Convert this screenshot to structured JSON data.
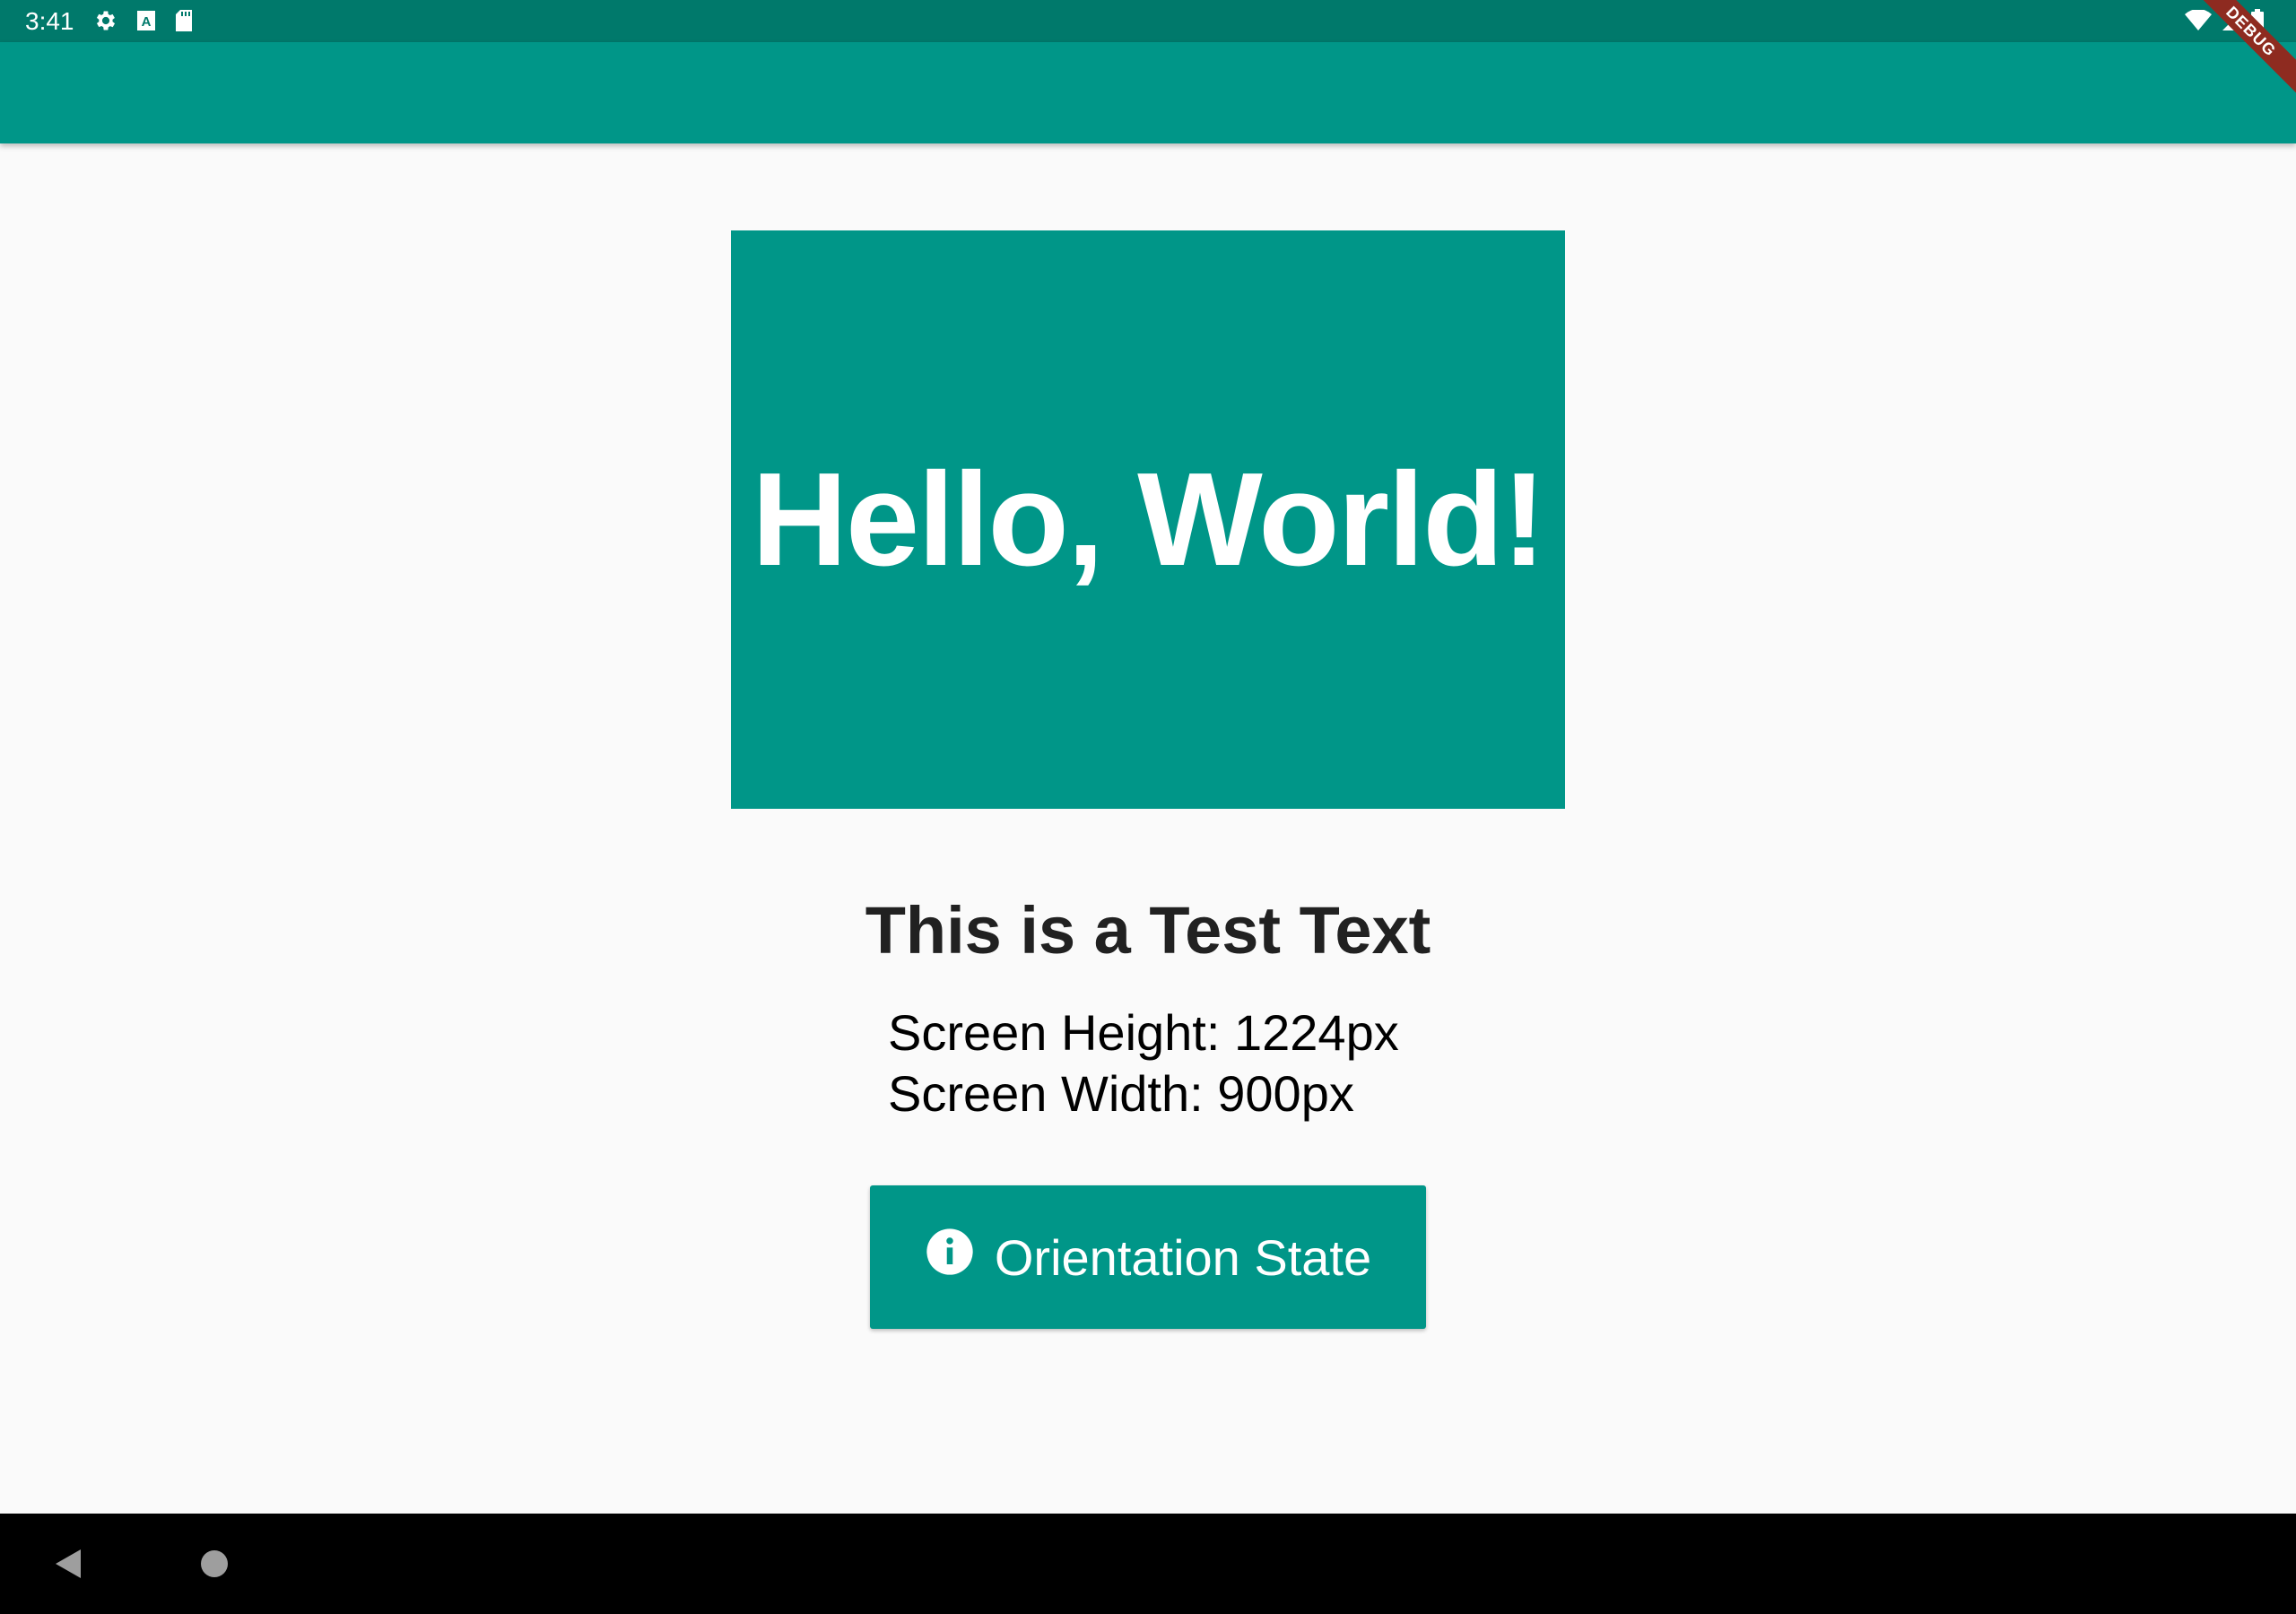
{
  "status_bar": {
    "time": "3:41",
    "icons_left": [
      "gear-icon",
      "font-a-icon",
      "sd-card-icon"
    ],
    "icons_right": [
      "wifi-icon",
      "signal-icon",
      "battery-icon"
    ]
  },
  "debug_banner": {
    "label": "DEBUG",
    "color": "#8e2b20"
  },
  "app_bar": {
    "title": "",
    "color": "#009688"
  },
  "main": {
    "hero_text": "Hello, World!",
    "subtitle": "This is a Test Text",
    "screen_height_line": "Screen Height: 1224px",
    "screen_width_line": "Screen Width: 900px",
    "button": {
      "label": "Orientation State",
      "icon": "info-icon"
    }
  },
  "nav_bar": {
    "icons": [
      "back-icon",
      "home-icon"
    ]
  },
  "colors": {
    "primary": "#009688",
    "primary_dark": "#00796b",
    "background": "#fafafa"
  }
}
